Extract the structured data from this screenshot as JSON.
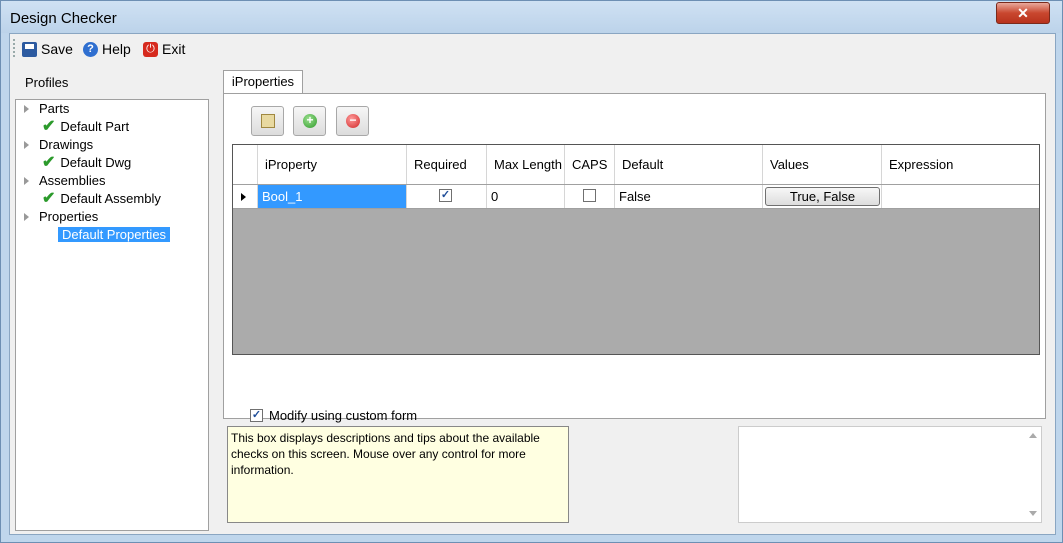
{
  "window": {
    "title": "Design Checker",
    "close_glyph": "✕"
  },
  "toolbar": {
    "save": "Save",
    "help": "Help",
    "exit": "Exit"
  },
  "profiles": {
    "label": "Profiles",
    "tree": [
      {
        "label": "Parts",
        "level": 0
      },
      {
        "label": "Default Part",
        "level": 1,
        "checked": true
      },
      {
        "label": "Drawings",
        "level": 0
      },
      {
        "label": "Default Dwg",
        "level": 1,
        "checked": true
      },
      {
        "label": "Assemblies",
        "level": 0
      },
      {
        "label": "Default Assembly",
        "level": 1,
        "checked": true
      },
      {
        "label": "Properties",
        "level": 0
      },
      {
        "label": "Default Properties",
        "level": 1,
        "selected": true
      }
    ]
  },
  "tab": {
    "label": "iProperties"
  },
  "grid": {
    "columns": [
      "iProperty",
      "Required",
      "Max Length",
      "CAPS",
      "Default",
      "Values",
      "Expression"
    ],
    "rows": [
      {
        "iproperty": "Bool_1",
        "required": true,
        "max_length": "0",
        "caps": false,
        "default": "False",
        "values": "True, False",
        "expression": ""
      }
    ]
  },
  "custom_form": {
    "label": "Modify using custom form",
    "checked": true
  },
  "help_text": "This box displays descriptions and tips about the available checks on this screen. Mouse over any control for more information.",
  "colors": {
    "selection": "#3399ff",
    "help_bg": "#ffffe1",
    "check_green": "#2b9a2b"
  }
}
